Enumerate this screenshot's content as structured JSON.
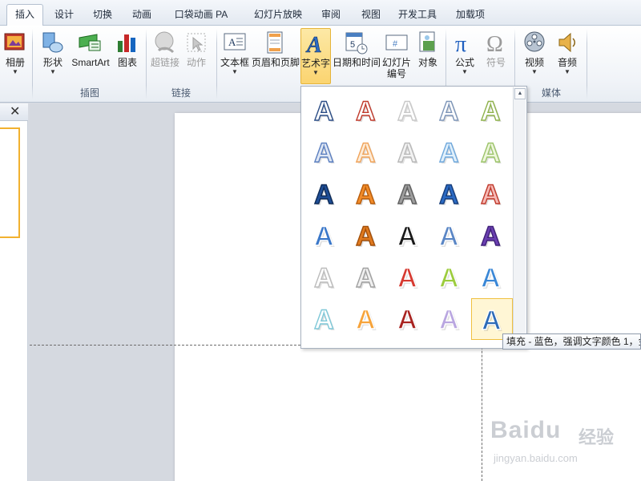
{
  "tabs": [
    {
      "label": "插入",
      "active": true
    },
    {
      "label": "设计"
    },
    {
      "label": "切换"
    },
    {
      "label": "动画"
    },
    {
      "label": "口袋动画 PA"
    },
    {
      "label": "幻灯片放映"
    },
    {
      "label": "审阅"
    },
    {
      "label": "视图"
    },
    {
      "label": "开发工具"
    },
    {
      "label": "加载项"
    }
  ],
  "ribbon": {
    "album": {
      "label": "相册"
    },
    "shapes": {
      "label": "形状"
    },
    "smartart": {
      "label": "SmartArt"
    },
    "chart": {
      "label": "图表"
    },
    "hyperlink": {
      "label": "超链接"
    },
    "action": {
      "label": "动作"
    },
    "textbox": {
      "label": "文本框"
    },
    "header_footer": {
      "label": "页眉和页脚"
    },
    "wordart": {
      "label": "艺术字"
    },
    "datetime": {
      "label": "日期和时间"
    },
    "slide_number": {
      "label_line1": "幻灯片",
      "label_line2": "编号"
    },
    "object": {
      "label": "对象"
    },
    "equation": {
      "label": "公式"
    },
    "symbol": {
      "label": "符号"
    },
    "video": {
      "label": "视频"
    },
    "audio": {
      "label": "音频"
    },
    "groups": {
      "illustrations": "插图",
      "links": "链接",
      "media": "媒体"
    }
  },
  "gallery": {
    "styles": [
      {
        "fill": "#ffffff",
        "stroke": "#2b4d86"
      },
      {
        "fill": "#ffffff",
        "stroke": "#c0392b"
      },
      {
        "fill": "#ffffff",
        "stroke": "#c8c8c8"
      },
      {
        "fill": "#ffffff",
        "stroke": "#7d95b8"
      },
      {
        "fill": "#ffffff",
        "stroke": "#8fb24c"
      },
      {
        "fill": "#dfe7f4",
        "stroke": "#5b7fc0"
      },
      {
        "fill": "#fdecd8",
        "stroke": "#f0a35a"
      },
      {
        "fill": "#f2f2f2",
        "stroke": "#b8b8b8"
      },
      {
        "fill": "#e1f0fb",
        "stroke": "#6fa8dc"
      },
      {
        "fill": "#eef6dc",
        "stroke": "#9cc46a"
      },
      {
        "fill": "#1f4e96",
        "stroke": "#0d2a56"
      },
      {
        "fill": "#f28c2a",
        "stroke": "#b85c0b"
      },
      {
        "fill": "#9d9d9d",
        "stroke": "#5f5f5f"
      },
      {
        "fill": "#2c6bc4",
        "stroke": "#163d7a"
      },
      {
        "fill": "#f6b9b5",
        "stroke": "#c0392b"
      },
      {
        "fill": "#3b78c9",
        "stroke": "#ffffff"
      },
      {
        "fill": "#e07a1f",
        "stroke": "#a24e08"
      },
      {
        "fill": "#1a1a1a",
        "stroke": "#ffffff"
      },
      {
        "fill": "#5a86c5",
        "stroke": "#ffffff"
      },
      {
        "fill": "#6a3fb0",
        "stroke": "#3e1f78"
      },
      {
        "fill": "#ffffff",
        "stroke": "#bcbcbc"
      },
      {
        "fill": "#f0f0f0",
        "stroke": "#a0a0a0"
      },
      {
        "fill": "#d63a31",
        "stroke": "#ffffff"
      },
      {
        "fill": "#9ccc3d",
        "stroke": "#ffffff"
      },
      {
        "fill": "#3a87d6",
        "stroke": "#ffffff"
      },
      {
        "fill": "#ffffff",
        "stroke": "#7fc8d8"
      },
      {
        "fill": "#f6a33a",
        "stroke": "#ffffff"
      },
      {
        "fill": "#a82320",
        "stroke": "#ffffff"
      },
      {
        "fill": "#b9a6e0",
        "stroke": "#ffffff"
      },
      {
        "fill": "#2e6bb8",
        "stroke": "#ffffff",
        "hover": true
      }
    ],
    "glyph": "A"
  },
  "tooltip": {
    "text": "填充 - 蓝色，强调文字颜色 1，金"
  },
  "watermark": {
    "brand": "Baidu",
    "brand_cn": "经验",
    "url": "jingyan.baidu.com"
  },
  "left_panel": {
    "close_glyph": "✕"
  }
}
